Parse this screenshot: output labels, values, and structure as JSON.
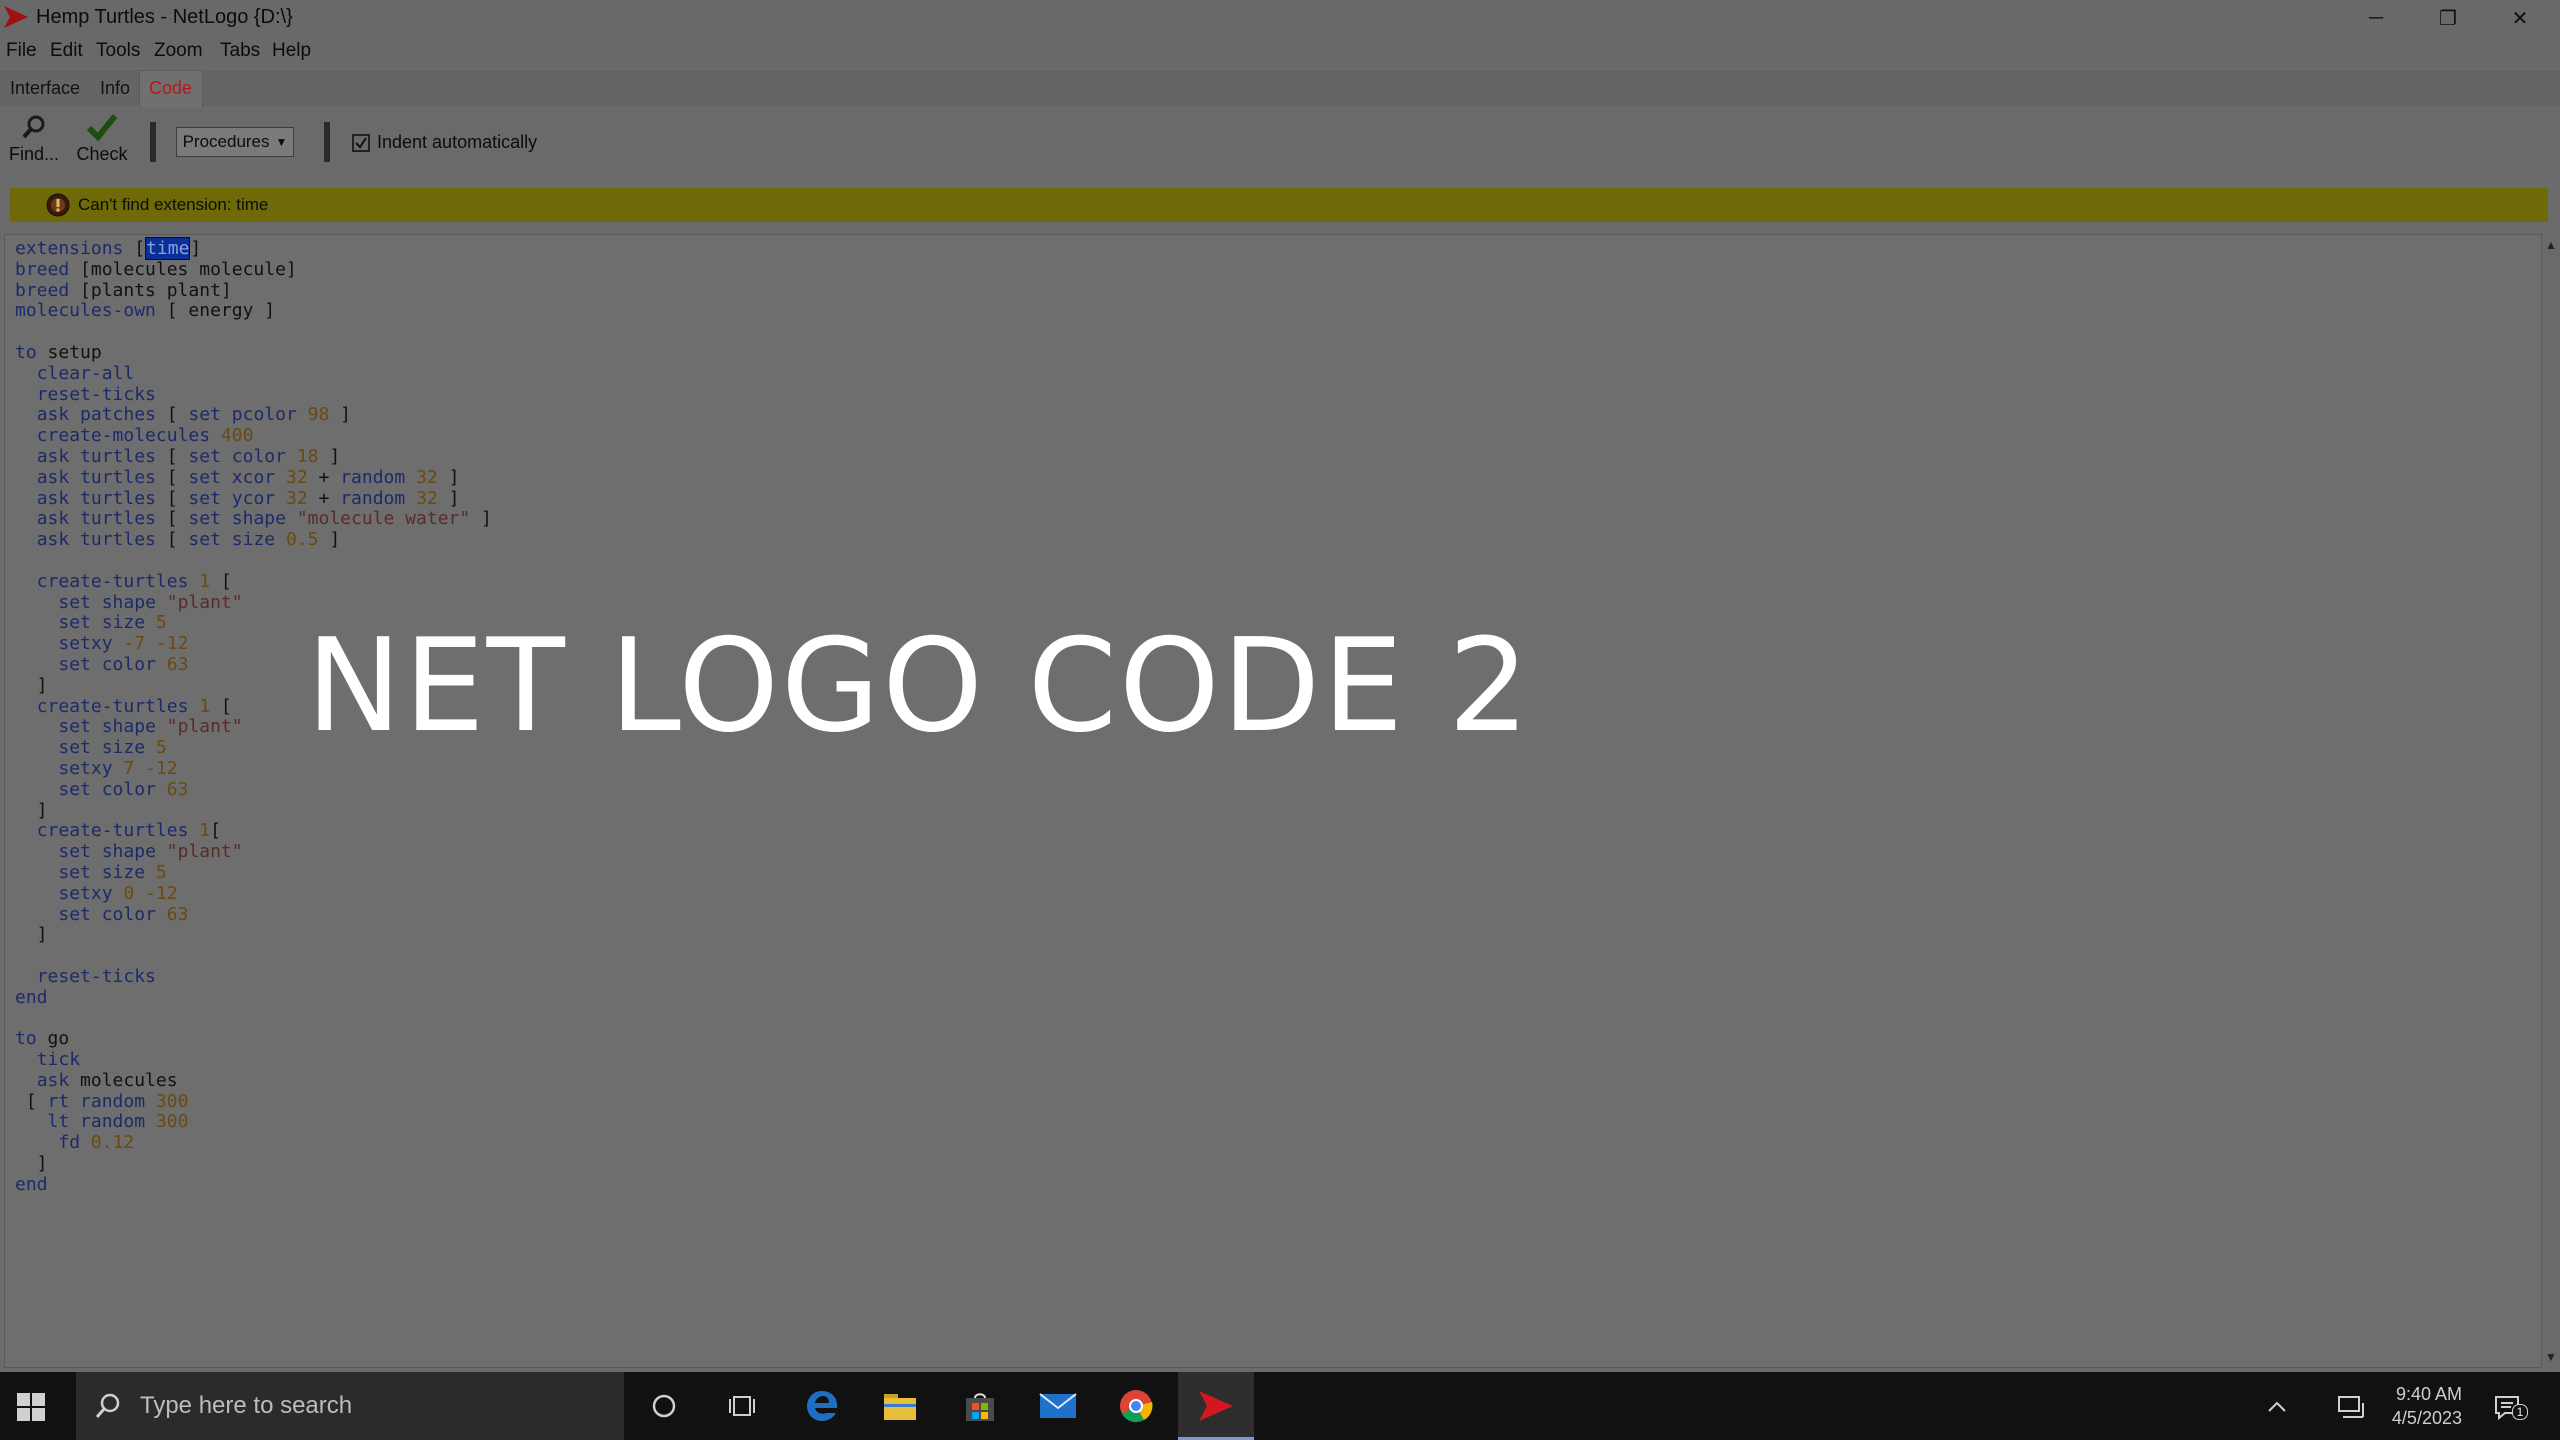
{
  "window": {
    "title": "Hemp Turtles - NetLogo {D:\\}",
    "minimize": "─",
    "restore": "❐",
    "close": "✕"
  },
  "menu": [
    "File",
    "Edit",
    "Tools",
    "Zoom",
    "Tabs",
    "Help"
  ],
  "tabs": [
    {
      "label": "Interface",
      "active": false
    },
    {
      "label": "Info",
      "active": false
    },
    {
      "label": "Code",
      "active": true
    }
  ],
  "toolbar": {
    "find_label": "Find...",
    "check_label": "Check",
    "procedures_label": "Procedures",
    "indent_label": "Indent automatically",
    "indent_checked": true
  },
  "error": {
    "message": "Can't find extension: time",
    "color": "#6f6a07"
  },
  "code_lines": [
    "extensions [time]",
    "breed [molecules molecule]",
    "breed [plants plant]",
    "molecules-own [ energy ]",
    "",
    "to setup",
    "  clear-all",
    "  reset-ticks",
    "  ask patches [ set pcolor 98 ]",
    "  create-molecules 400",
    "  ask turtles [ set color 18 ]",
    "  ask turtles [ set xcor 32 + random 32 ]",
    "  ask turtles [ set ycor 32 + random 32 ]",
    "  ask turtles [ set shape \"molecule water\" ]",
    "  ask turtles [ set size 0.5 ]",
    "",
    "  create-turtles 1 [",
    "    set shape \"plant\"",
    "    set size 5",
    "    setxy -7 -12",
    "    set color 63",
    "  ]",
    "  create-turtles 1 [",
    "    set shape \"plant\"",
    "    set size 5",
    "    setxy 7 -12",
    "    set color 63",
    "  ]",
    "  create-turtles 1[",
    "    set shape \"plant\"",
    "    set size 5",
    "    setxy 0 -12",
    "    set color 63",
    "  ]",
    "",
    "  reset-ticks",
    "end",
    "",
    "to go",
    "  tick",
    "  ask molecules",
    " [ rt random 300",
    "   lt random 300",
    "    fd 0.12",
    "  ]",
    "end"
  ],
  "overlay": {
    "title": "NET LOGO CODE 2"
  },
  "taskbar": {
    "search_placeholder": "Type here to search",
    "time": "9:40 AM",
    "date": "4/5/2023",
    "notification_count": "1",
    "apps": [
      "cortana-icon",
      "task-view-icon",
      "edge-icon",
      "file-explorer-icon",
      "store-icon",
      "mail-icon",
      "chrome-icon",
      "netlogo-icon"
    ]
  }
}
